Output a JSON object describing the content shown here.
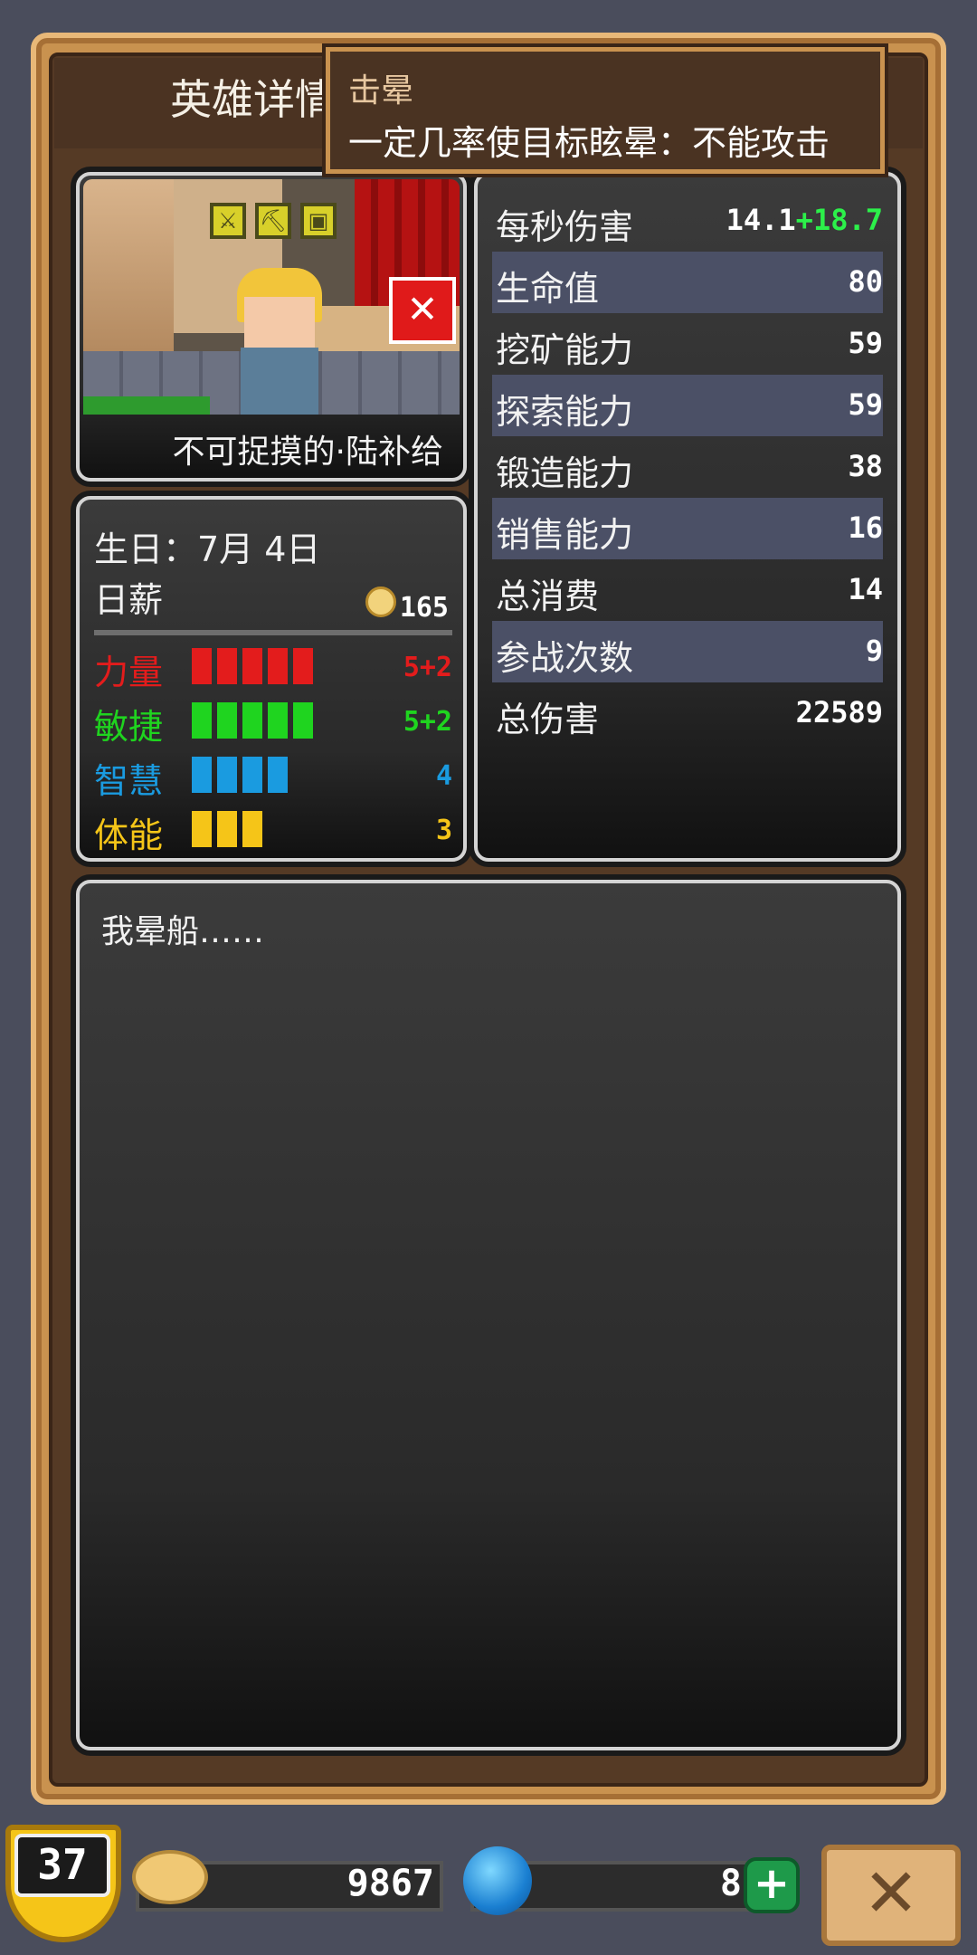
{
  "window": {
    "title": "英雄详情"
  },
  "tooltip": {
    "title": "击晕",
    "description": "一定几率使目标眩晕：不能攻击"
  },
  "hero": {
    "name": "不可捉摸的·陆补给",
    "status_icon": "stun-icon"
  },
  "stats": [
    {
      "label": "每秒伤害",
      "value": "14.1",
      "bonus": "+18.7"
    },
    {
      "label": "生命值",
      "value": "80"
    },
    {
      "label": "挖矿能力",
      "value": "59"
    },
    {
      "label": "探索能力",
      "value": "59"
    },
    {
      "label": "锻造能力",
      "value": "38"
    },
    {
      "label": "销售能力",
      "value": "16"
    },
    {
      "label": "总消费",
      "value": "14"
    },
    {
      "label": "参战次数",
      "value": "9"
    },
    {
      "label": "总伤害",
      "value": "22589"
    }
  ],
  "info": {
    "birthday": "生日：7月 4日",
    "salary_label": "日薪",
    "salary_value": "165"
  },
  "attributes": [
    {
      "label": "力量",
      "value": "5+2",
      "bars": 5,
      "color": "#e31c1c"
    },
    {
      "label": "敏捷",
      "value": "5+2",
      "bars": 5,
      "color": "#1fd41f"
    },
    {
      "label": "智慧",
      "value": "4",
      "bars": 4,
      "color": "#1a9be0"
    },
    {
      "label": "体能",
      "value": "3",
      "bars": 3,
      "color": "#f5c518"
    }
  ],
  "description": "我晕船……",
  "footer": {
    "level": "37",
    "coins": "9867",
    "gems": "8",
    "add_label": "+",
    "close_label": "✕"
  }
}
